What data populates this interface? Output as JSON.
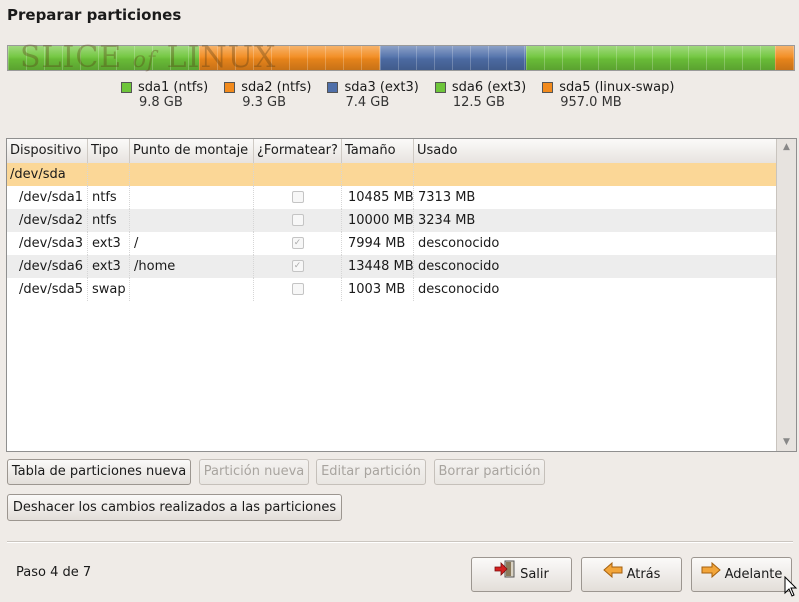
{
  "title": "Preparar particiones",
  "watermark": {
    "a": "SLICE",
    "b": "of",
    "c": "LINUX"
  },
  "partition_bar": [
    {
      "color": "#6ec53a",
      "fraction": 0.2425
    },
    {
      "color": "#f28a1c",
      "fraction": 0.2312
    },
    {
      "color": "#4f6fa9",
      "fraction": 0.1853
    },
    {
      "color": "#6ec53a",
      "fraction": 0.3173
    },
    {
      "color": "#f28a1c",
      "fraction": 0.0237
    }
  ],
  "legend": [
    {
      "label": "sda1 (ntfs)",
      "size": "9.8 GB",
      "color": "#6ec53a"
    },
    {
      "label": "sda2 (ntfs)",
      "size": "9.3 GB",
      "color": "#f28a1c"
    },
    {
      "label": "sda3 (ext3)",
      "size": "7.4 GB",
      "color": "#4f6fa9"
    },
    {
      "label": "sda6 (ext3)",
      "size": "12.5 GB",
      "color": "#6ec53a"
    },
    {
      "label": "sda5 (linux-swap)",
      "size": "957.0 MB",
      "color": "#f28a1c"
    }
  ],
  "table": {
    "columns": [
      "Dispositivo",
      "Tipo",
      "Punto de montaje",
      "¿Formatear?",
      "Tamaño",
      "Usado"
    ],
    "disk": "/dev/sda",
    "rows": [
      {
        "device": "/dev/sda1",
        "type": "ntfs",
        "mount": "",
        "format": false,
        "size": "10485 MB",
        "used": "7313 MB"
      },
      {
        "device": "/dev/sda2",
        "type": "ntfs",
        "mount": "",
        "format": false,
        "size": "10000 MB",
        "used": "3234 MB"
      },
      {
        "device": "/dev/sda3",
        "type": "ext3",
        "mount": "/",
        "format": true,
        "size": "7994 MB",
        "used": "desconocido"
      },
      {
        "device": "/dev/sda6",
        "type": "ext3",
        "mount": "/home",
        "format": true,
        "size": "13448 MB",
        "used": "desconocido"
      },
      {
        "device": "/dev/sda5",
        "type": "swap",
        "mount": "",
        "format": false,
        "size": "1003 MB",
        "used": "desconocido"
      }
    ]
  },
  "buttons": {
    "new_table": "Tabla de particiones nueva",
    "new_partition": "Partición nueva",
    "edit_partition": "Editar partición",
    "delete_partition": "Borrar partición",
    "undo": "Deshacer los cambios realizados a las particiones"
  },
  "footer": {
    "step": "Paso 4 de 7",
    "quit": "Salir",
    "back": "Atrás",
    "forward": "Adelante"
  }
}
